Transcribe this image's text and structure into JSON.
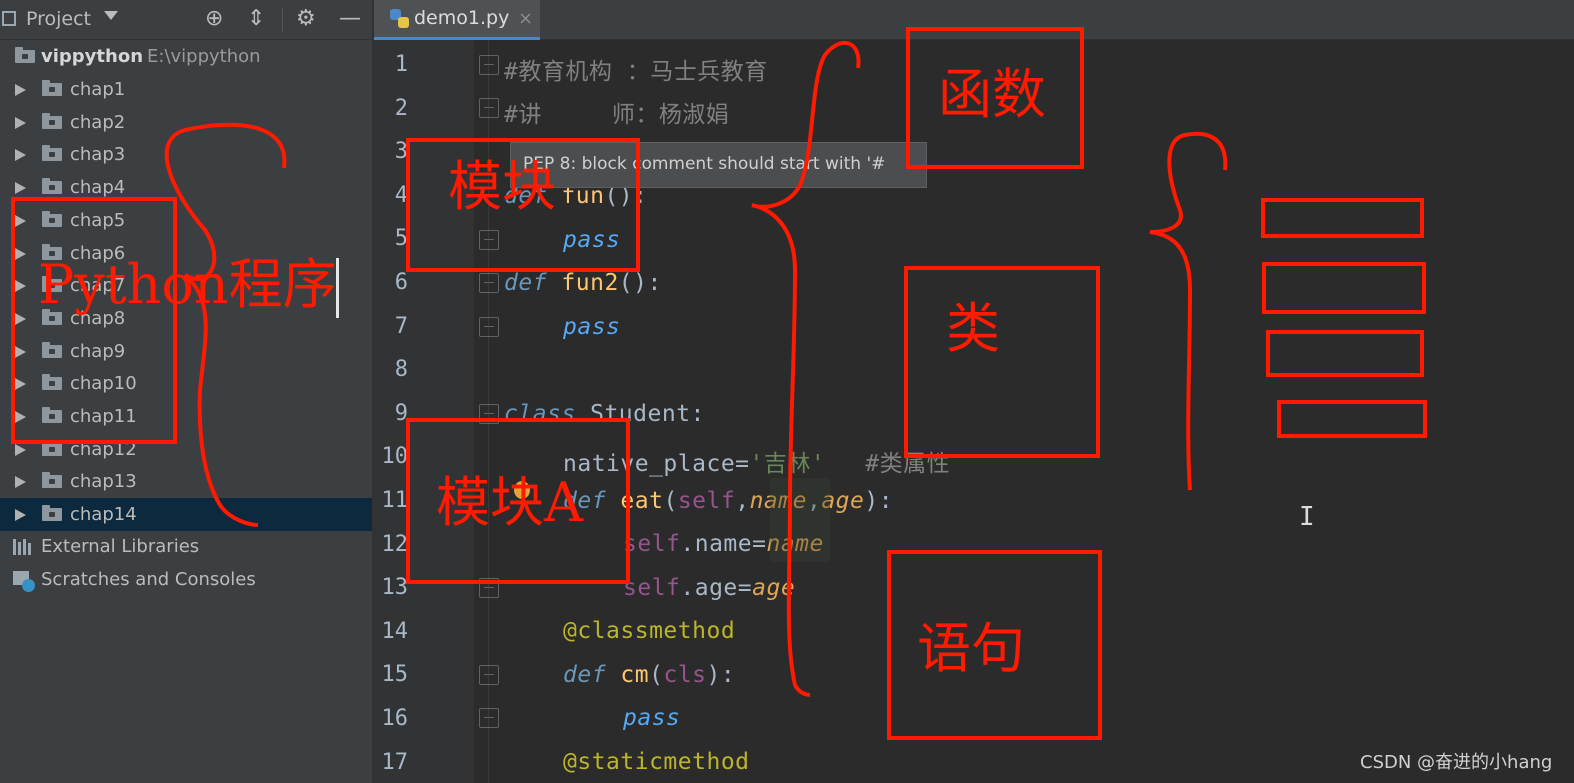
{
  "left_panel": {
    "header_title": "Project",
    "root": {
      "name": "vippython",
      "path": "E:\\vippython"
    },
    "folders": [
      "chap1",
      "chap2",
      "chap3",
      "chap4",
      "chap5",
      "chap6",
      "chap7",
      "chap8",
      "chap9",
      "chap10",
      "chap11",
      "chap12",
      "chap13",
      "chap14"
    ],
    "selected_folder": "chap14",
    "external_libraries": "External Libraries",
    "scratches": "Scratches and Consoles",
    "header_icons": [
      "locate-icon",
      "collapse-icon",
      "gear-icon",
      "minimize-icon"
    ]
  },
  "editor": {
    "tab": {
      "label": "demo1.py",
      "close": "×"
    },
    "line_numbers": [
      "1",
      "2",
      "3",
      "4",
      "5",
      "6",
      "7",
      "8",
      "9",
      "10",
      "11",
      "12",
      "13",
      "14",
      "15",
      "16",
      "17"
    ],
    "tooltip": "PEP 8: block comment should start with '#",
    "code": {
      "l1": "#教育机构 ：马士兵教育",
      "l2_a": "#讲",
      "l2_b": "师：杨淑娟",
      "l4_kw": "def",
      "l4_fn": "fun",
      "l4_p": "():",
      "l5": "pass",
      "l6_kw": "def",
      "l6_fn": "fun2",
      "l6_p": "():",
      "l7": "pass",
      "l9_kw": "class",
      "l9_cl": "Student",
      "l9_p": ":",
      "l10_a": "native_place=",
      "l10_s": "'吉林'",
      "l10_c": "#类属性",
      "l11_kw": "def",
      "l11_fn": "eat",
      "l11_o": "(",
      "l11_self": "self",
      "l11_c1": ",",
      "l11_name": "name",
      "l11_c2": ",",
      "l11_age": "age",
      "l11_cl": "):",
      "l12_self": "self",
      "l12_a": ".name=",
      "l12_name": "name",
      "l13_self": "self",
      "l13_a": ".age=",
      "l13_age": "age",
      "l14": "@classmethod",
      "l15_kw": "def",
      "l15_fn": "cm",
      "l15_o": "(",
      "l15_cls": "cls",
      "l15_cl": "):",
      "l16": "pass",
      "l17": "@staticmethod"
    }
  },
  "annotations": {
    "python_program": "Python程序",
    "module": "模块",
    "module_a": "模块A",
    "function": "函数",
    "class": "类",
    "statement": "语句"
  },
  "watermark": "CSDN @奋进的小hang",
  "colors": {
    "annotation_red": "#ff1a00",
    "selection": "#0d293e"
  }
}
